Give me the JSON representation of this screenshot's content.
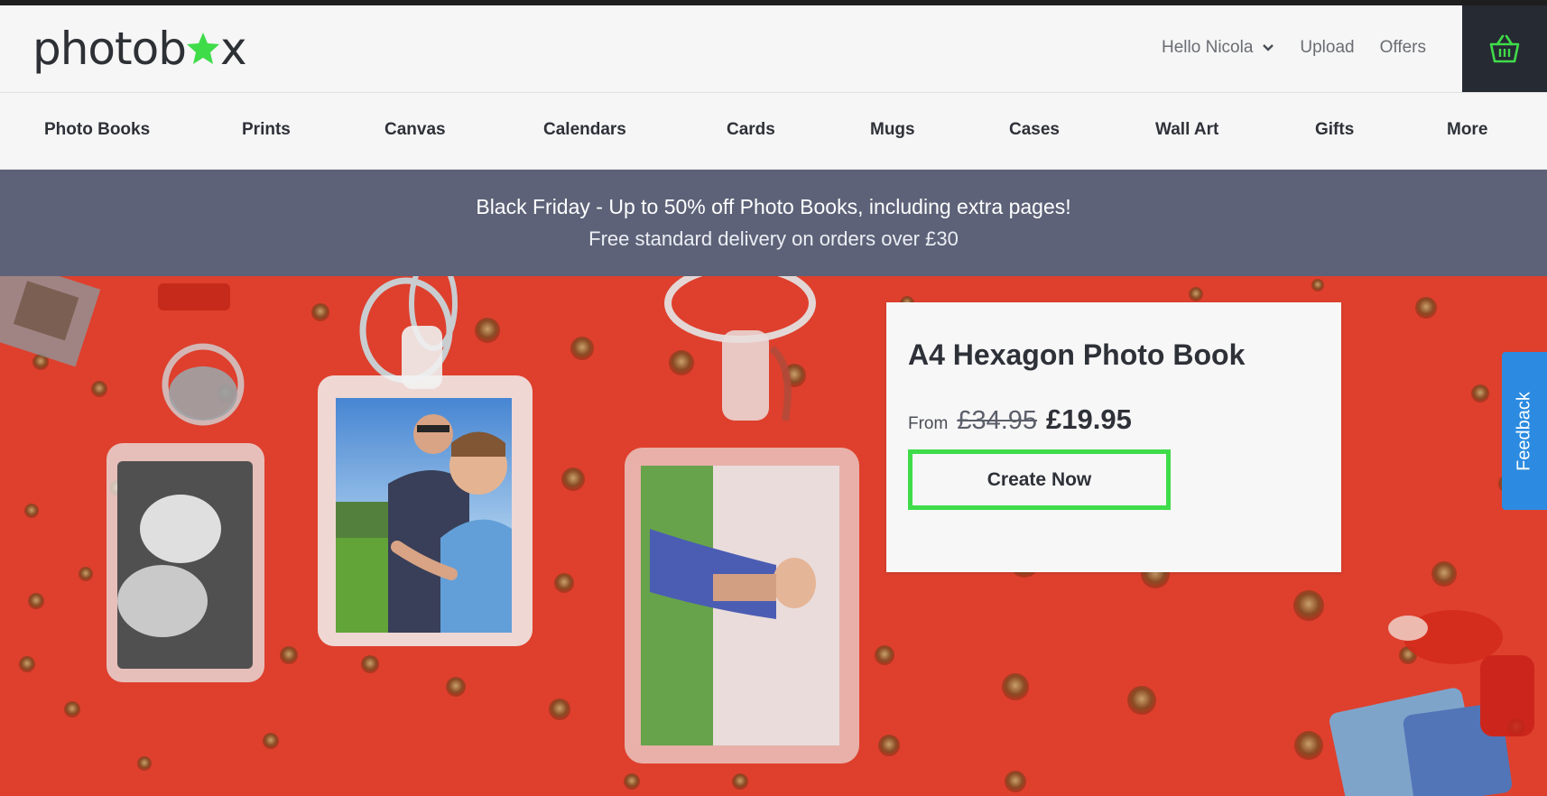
{
  "brand": {
    "logo_pre": "photob",
    "logo_post": "x",
    "star_color": "#3fdc4a",
    "text_color": "#2d3035"
  },
  "header": {
    "greeting": "Hello Nicola",
    "upload": "Upload",
    "offers": "Offers",
    "basket_icon": "basket-icon"
  },
  "categories": [
    "Photo Books",
    "Prints",
    "Canvas",
    "Calendars",
    "Cards",
    "Mugs",
    "Cases",
    "Wall Art",
    "Gifts",
    "More"
  ],
  "promo": {
    "line1": "Black Friday - Up to 50% off Photo Books, including extra pages!",
    "line2": "Free standard delivery on orders over £30",
    "background": "#5d6278"
  },
  "hero": {
    "background": "#e3432f",
    "product_title": "A4 Hexagon Photo Book",
    "from_label": "From",
    "old_price": "£34.95",
    "new_price": "£19.95",
    "cta_label": "Create Now",
    "cta_border": "#3fdc4a"
  },
  "feedback": {
    "label": "Feedback",
    "color": "#2c8be0"
  }
}
